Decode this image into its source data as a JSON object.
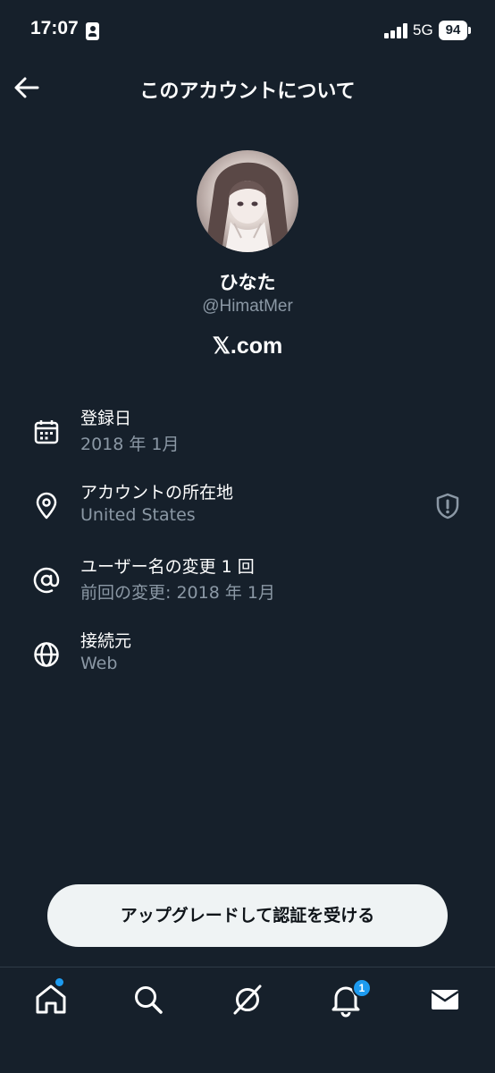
{
  "status_bar": {
    "time": "17:07",
    "network": "5G",
    "battery": "94"
  },
  "header": {
    "title": "このアカウントについて"
  },
  "profile": {
    "display_name": "ひなた",
    "handle": "@HimatMer",
    "site": "𝕏.com"
  },
  "info": {
    "joined": {
      "title": "登録日",
      "value": "2018 年 1月"
    },
    "location": {
      "title": "アカウントの所在地",
      "value": "United States"
    },
    "username_changes": {
      "title": "ユーザー名の変更 1 回",
      "value": "前回の変更: 2018 年 1月"
    },
    "connected_via": {
      "title": "接続元",
      "value": "Web"
    }
  },
  "upgrade_button": {
    "label": "アップグレードして認証を受ける"
  },
  "tab_bar": {
    "notifications_badge": "1",
    "items": [
      "home-icon",
      "search-icon",
      "grok-icon",
      "bell-icon",
      "mail-icon"
    ]
  },
  "colors": {
    "background": "#16202b",
    "secondary_text": "#8b98a5",
    "accent": "#1d9bf0",
    "button_bg": "#eff3f4"
  }
}
